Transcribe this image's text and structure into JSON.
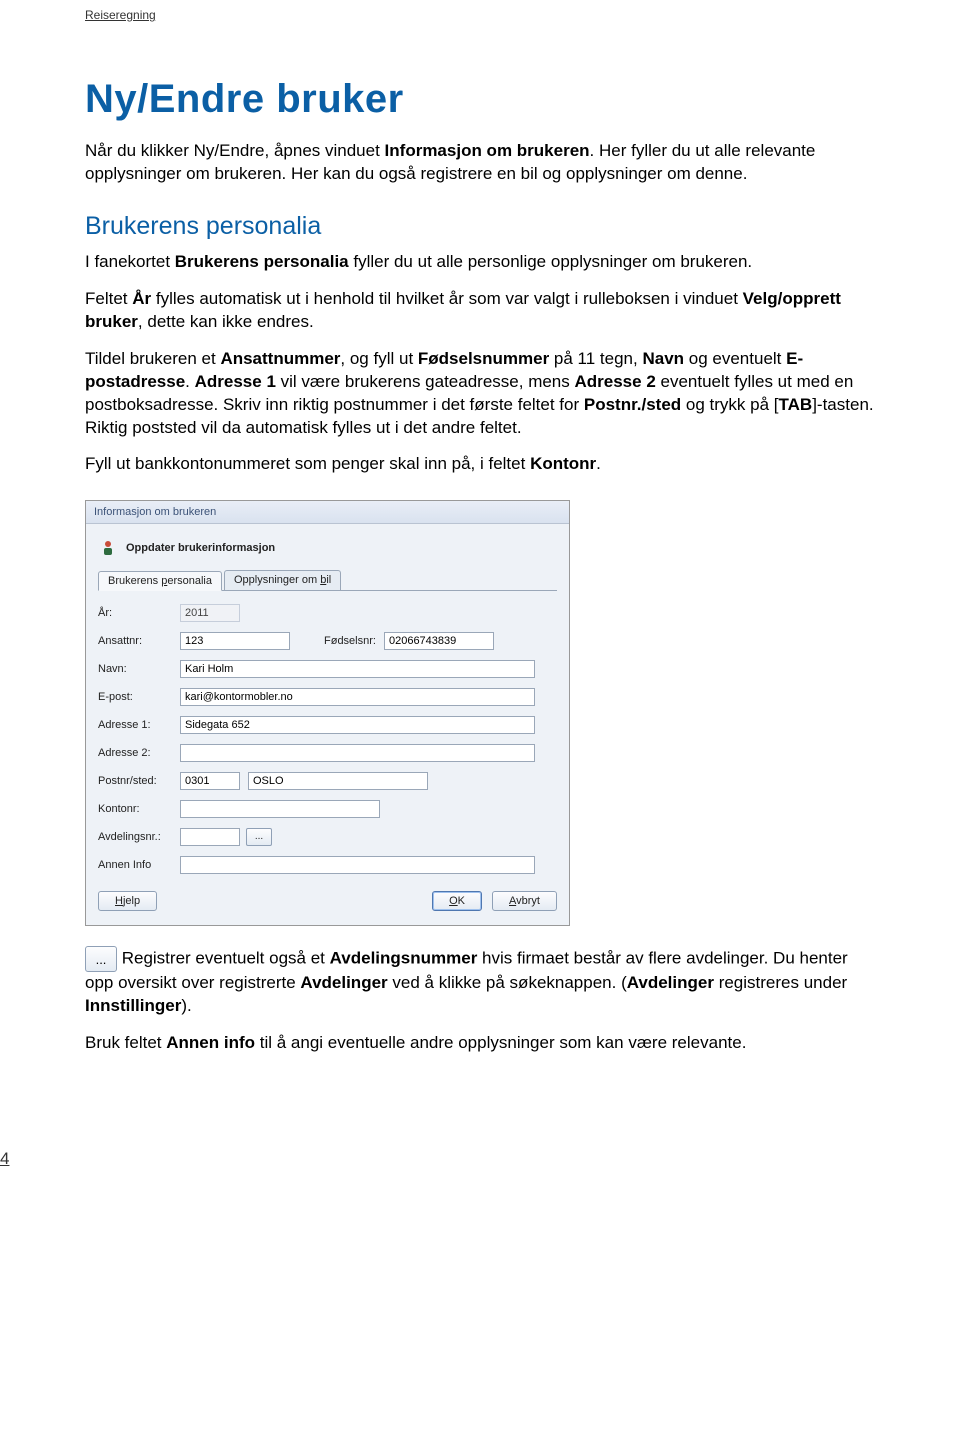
{
  "header": {
    "label": "Reiseregning"
  },
  "title": "Ny/Endre bruker",
  "intro_parts": {
    "p1a": "Når du klikker Ny/Endre, åpnes vinduet ",
    "p1b": "Informasjon om brukeren",
    "p1c": ". Her fyller du ut alle relevante opplysninger om brukeren. Her kan du også registrere en bil og opplysninger om denne."
  },
  "section2": {
    "heading": "Brukerens personalia",
    "p1a": "I fanekortet ",
    "p1b": "Brukerens personalia",
    "p1c": " fyller du ut alle personlige opplysninger om brukeren.",
    "p2a": "Feltet ",
    "p2b": "År",
    "p2c": " fylles automatisk ut i henhold til hvilket år som var valgt i rulleboksen i vinduet ",
    "p2d": "Velg/opprett bruker",
    "p2e": ", dette kan ikke endres.",
    "p3a": "Tildel brukeren et ",
    "p3b": "Ansattnummer",
    "p3c": ", og fyll ut ",
    "p3d": "Fødselsnummer",
    "p3e": " på 11 tegn, ",
    "p3f": "Navn",
    "p3g": " og eventuelt ",
    "p3h": "E-postadresse",
    "p3i": ". ",
    "p3j": "Adresse 1",
    "p3k": " vil være brukerens gateadresse, mens ",
    "p3l": "Adresse 2",
    "p3m": " eventuelt fylles ut med en postboksadresse. Skriv inn riktig postnummer i det første feltet for ",
    "p3n": "Postnr./sted",
    "p3o": " og trykk på [",
    "p3p": "TAB",
    "p3q": "]-tasten. Riktig poststed vil da automatisk fylles ut i det andre feltet.",
    "p4a": "Fyll ut bankkontonummeret som penger skal inn på, i feltet ",
    "p4b": "Kontonr",
    "p4c": "."
  },
  "dialog": {
    "title": "Informasjon om brukeren",
    "header_label": "Oppdater brukerinformasjon",
    "tabs": {
      "active_a": "Brukerens ",
      "active_key": "p",
      "active_b": "ersonalia",
      "other_a": "Opplysninger om ",
      "other_key": "b",
      "other_b": "il"
    },
    "labels": {
      "year": "År:",
      "ansattnr": "Ansattnr:",
      "fodselsnr": "Fødselsnr:",
      "navn": "Navn:",
      "epost": "E-post:",
      "adresse1": "Adresse 1:",
      "adresse2": "Adresse 2:",
      "postnr_sted": "Postnr/sted:",
      "kontonr": "Kontonr:",
      "avdelingsnr": "Avdelingsnr.:",
      "annen_info": "Annen Info"
    },
    "values": {
      "year": "2011",
      "ansattnr": "123",
      "fodselsnr": "02066743839",
      "navn": "Kari Holm",
      "epost": "kari@kontormobler.no",
      "adresse1": "Sidegata 652",
      "adresse2": "",
      "postnr": "0301",
      "sted": "OSLO",
      "kontonr": "",
      "avdelingsnr": "",
      "annen_info": ""
    },
    "lookup_label": "...",
    "buttons": {
      "help_key": "H",
      "help_rest": "jelp",
      "ok_key": "O",
      "ok_rest": "K",
      "cancel_key": "A",
      "cancel_rest": "vbryt"
    }
  },
  "after": {
    "lookup_label": "...",
    "p1a": " Registrer eventuelt også et ",
    "p1b": "Avdelingsnummer",
    "p1c": " hvis firmaet består av flere avdelinger. Du henter opp oversikt over registrerte ",
    "p1d": "Avdelinger",
    "p1e": " ved å klikke på søkeknappen. (",
    "p1f": "Avdelinger",
    "p1g": " registreres under ",
    "p1h": "Innstillinger",
    "p1i": ").",
    "p2a": "Bruk feltet ",
    "p2b": "Annen info",
    "p2c": " til å angi eventuelle andre opplysninger som kan være relevante."
  },
  "page_number": "4"
}
